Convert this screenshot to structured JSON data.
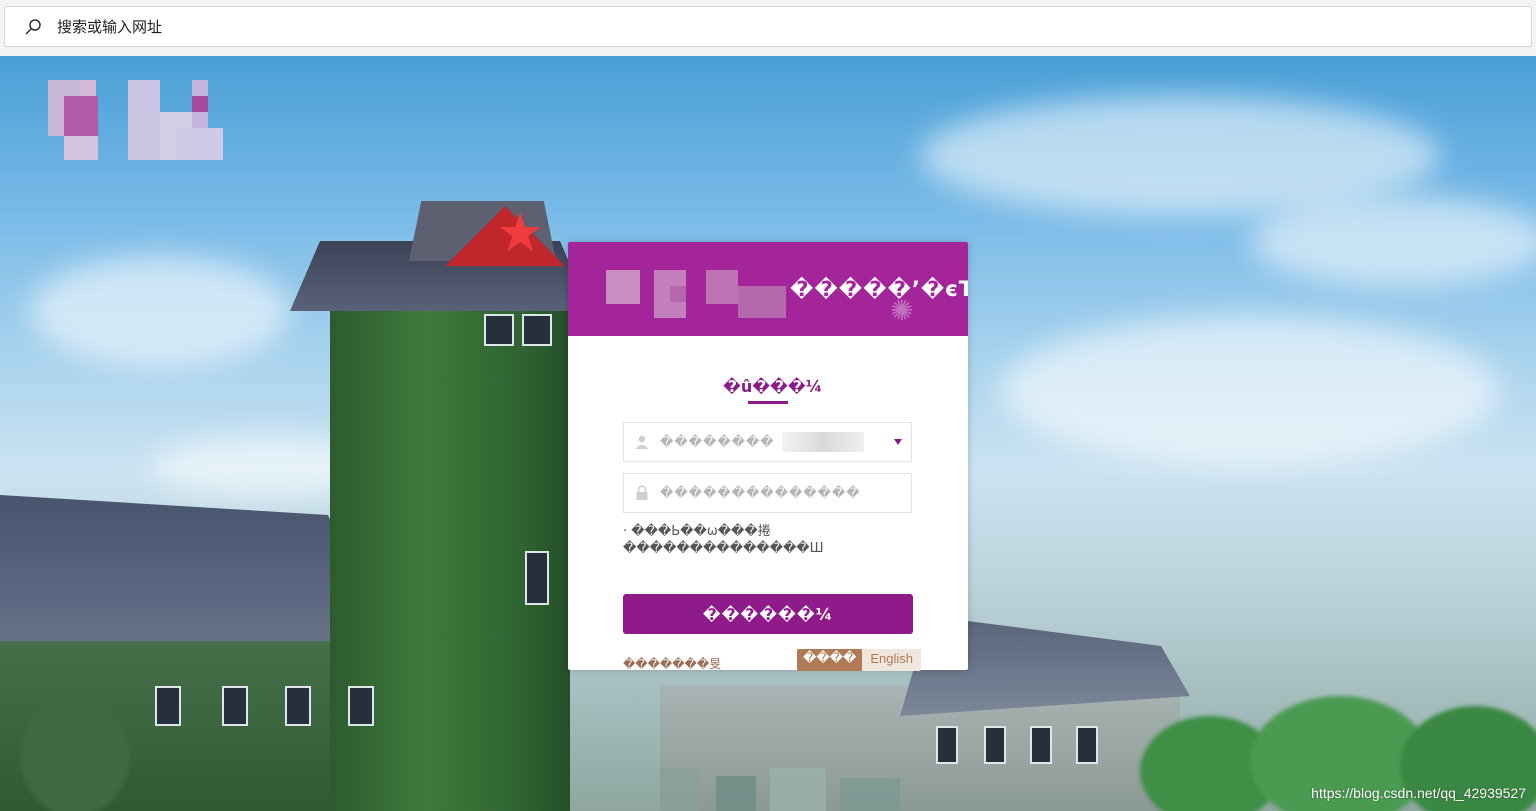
{
  "browser": {
    "address_placeholder": "搜索或输入网址"
  },
  "login": {
    "header_title": "�����’�єТ",
    "tab_label": "�û���¼",
    "username_placeholder": "��������",
    "password_placeholder": "��������������",
    "notice_line1": "· ���Ь��ѡ���捲",
    "notice_line2": "��������������Ш",
    "login_button": "������¼",
    "forgot_link": "�������旻",
    "lang_chinese": "����",
    "lang_english": "English"
  },
  "watermark": "https://blog.csdn.net/qq_42939527",
  "colors": {
    "brand_purple": "#a4249a",
    "button_purple": "#8f1a8a",
    "link_brown": "#9a6e52"
  }
}
